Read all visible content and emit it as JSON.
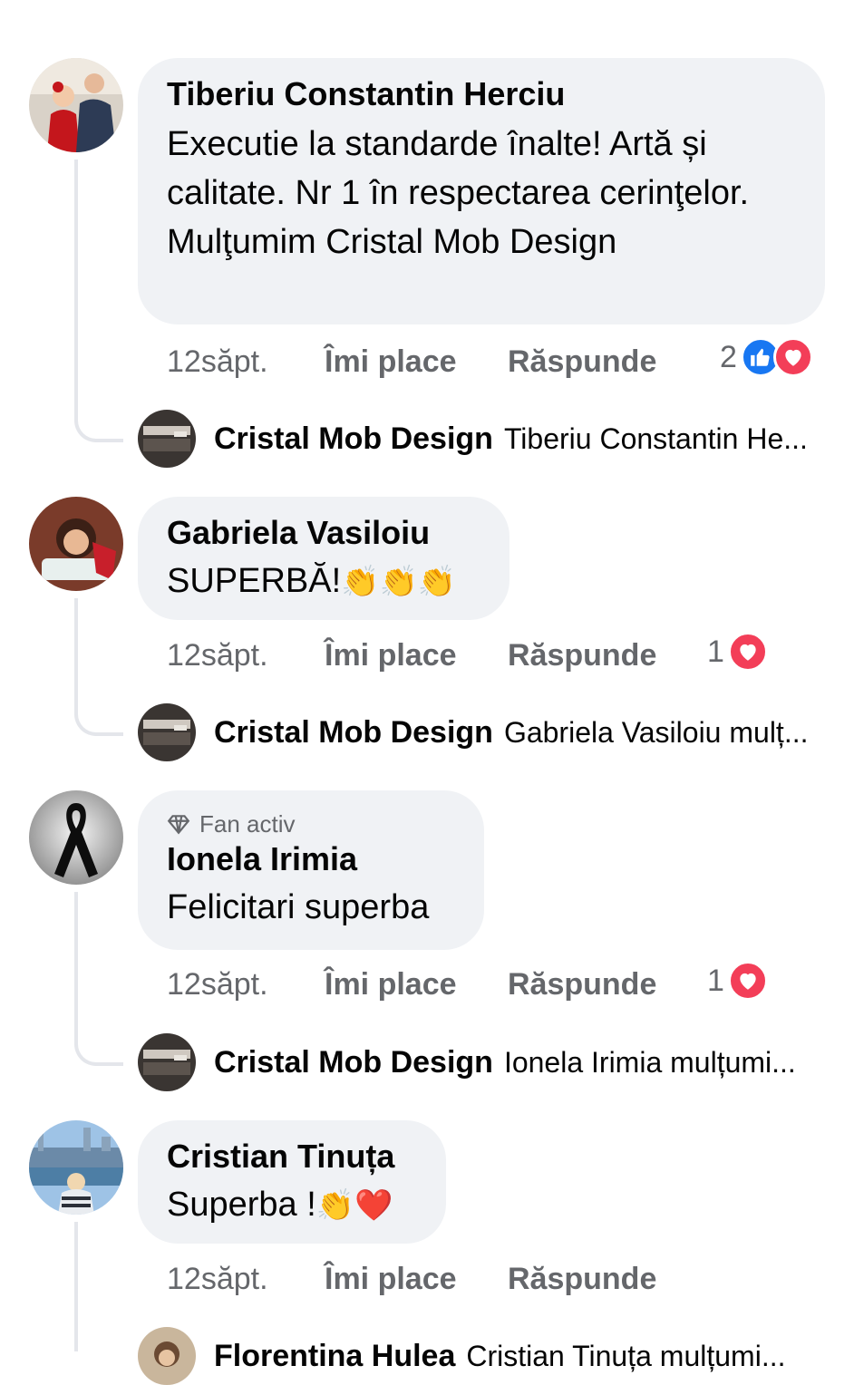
{
  "comments": [
    {
      "author": "Tiberiu Constantin Herciu",
      "text": "Executie la standarde înalte! Artă și calitate. Nr 1 în respectarea cerinţelor. Mulţumim Cristal Mob Design",
      "time": "12săpt.",
      "like": "Îmi place",
      "reply": "Răspunde",
      "reaction_count": "2",
      "reactions": [
        "like-icon",
        "love-icon"
      ],
      "reply_preview": {
        "author": "Cristal Mob Design",
        "text": "Tiberiu Constantin He..."
      }
    },
    {
      "author": "Gabriela Vasiloiu",
      "text": "SUPERBĂ!",
      "emojis": "👏👏👏",
      "time": "12săpt.",
      "like": "Îmi place",
      "reply": "Răspunde",
      "reaction_count": "1",
      "reactions": [
        "love-icon"
      ],
      "reply_preview": {
        "author": "Cristal Mob Design",
        "text": "Gabriela Vasiloiu mulț..."
      }
    },
    {
      "badge": "Fan activ",
      "author": "Ionela Irimia",
      "text": "Felicitari superba",
      "time": "12săpt.",
      "like": "Îmi place",
      "reply": "Răspunde",
      "reaction_count": "1",
      "reactions": [
        "love-icon"
      ],
      "reply_preview": {
        "author": "Cristal Mob Design",
        "text": "Ionela Irimia mulțumi..."
      }
    },
    {
      "author": "Cristian Tinuța",
      "text": "Superba !",
      "emojis": "👏❤️",
      "time": "12săpt.",
      "like": "Îmi place",
      "reply": "Răspunde",
      "reply_preview": {
        "author": "Florentina Hulea",
        "text": "Cristian Tinuța mulțumi..."
      }
    }
  ],
  "colors": {
    "bubble": "#f0f2f5",
    "like": "#1877f2",
    "love": "#f33e58",
    "meta": "#65676b"
  }
}
